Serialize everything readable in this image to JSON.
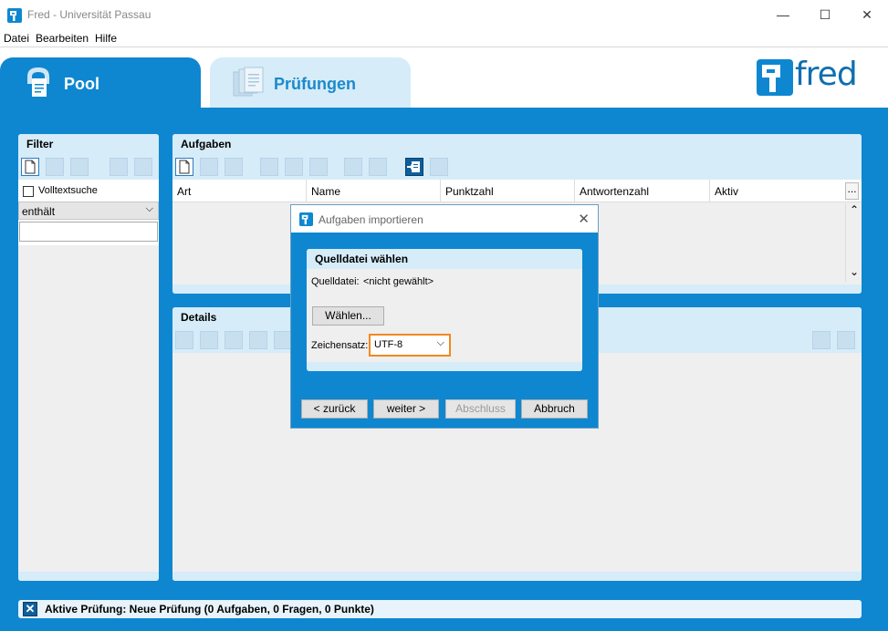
{
  "window": {
    "title": "Fred - Universität Passau",
    "minimize": "—",
    "maximize": "☐",
    "close": "✕"
  },
  "menu": [
    "Datei",
    "Bearbeiten",
    "Hilfe"
  ],
  "tabs": {
    "pool": "Pool",
    "pruefungen": "Prüfungen"
  },
  "logo": "fred",
  "filter": {
    "title": "Filter",
    "fulltext_label": "Volltextsuche",
    "mode_value": "enthält",
    "search_value": ""
  },
  "aufgaben": {
    "title": "Aufgaben",
    "columns": [
      "Art",
      "Name",
      "Punktzahl",
      "Antwortenzahl",
      "Aktiv"
    ],
    "more_button": "..."
  },
  "details": {
    "title": "Details"
  },
  "dialog": {
    "title": "Aufgaben importieren",
    "section_title": "Quelldatei wählen",
    "source_label": "Quelldatei:",
    "source_value": "<nicht gewählt>",
    "choose_button": "Wählen...",
    "charset_label": "Zeichensatz:",
    "charset_value": "UTF-8",
    "back_button": "< zurück",
    "next_button": "weiter >",
    "finish_button": "Abschluss",
    "cancel_button": "Abbruch"
  },
  "status": {
    "text": "Aktive Prüfung: Neue Prüfung (0 Aufgaben, 0 Fragen, 0 Punkte)"
  },
  "colors": {
    "accent": "#0e87d0",
    "light": "#d6ecf8",
    "highlight": "#f08a1e"
  }
}
